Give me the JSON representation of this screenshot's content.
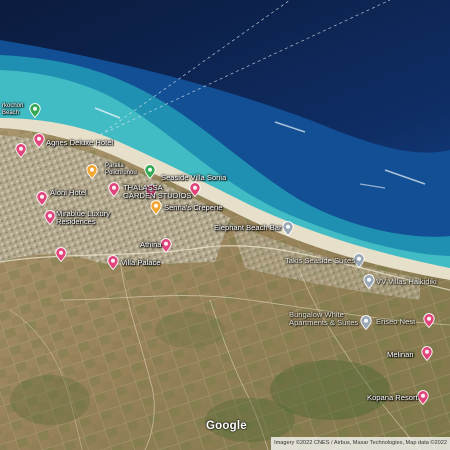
{
  "colors": {
    "deep_sea": "#0b1b3d",
    "mid_sea": "#12478c",
    "shallow_sea": "#2ca9bf",
    "turquoise": "#49c6c6",
    "beach": "#e8e0c8",
    "land": "#9e8760",
    "town": "#b1a88f",
    "hotel_pin": "#e0457b",
    "orange_pin": "#f2a531",
    "green_pin": "#34a853",
    "place_pin": "#9aa7b4"
  },
  "places": [
    {
      "name": "rkochori Beach",
      "kind": "green",
      "label_lines": [
        "rkochori",
        "Beach"
      ]
    },
    {
      "name": "Agnes Deluxe Hotel",
      "kind": "hotel",
      "label_lines": [
        "Agnes Deluxe Hotel"
      ]
    },
    {
      "name": "Paralia Polichronou",
      "kind": "green",
      "label_lines": [
        "Paralia",
        "Polichronou"
      ]
    },
    {
      "name": "Seaside Villa Sonia",
      "kind": "hotel",
      "label_lines": [
        "Seaside Villa Sonia"
      ]
    },
    {
      "name": "Aloni Hotel",
      "kind": "hotel",
      "label_lines": [
        "Aloni Hotel"
      ]
    },
    {
      "name": "THALASSA GARDEN STUDIOS",
      "kind": "hotel",
      "label_lines": [
        "THALASSA",
        "GARDEN STUDIOS"
      ]
    },
    {
      "name": "Mirablue Luxury Residences",
      "kind": "hotel",
      "label_lines": [
        "Mirablue Luxury",
        "Residences"
      ]
    },
    {
      "name": "Senna's Creperie",
      "kind": "orange",
      "label_lines": [
        "Senna's Creperie"
      ]
    },
    {
      "name": "Elephant Beach Bar",
      "kind": "place",
      "label_lines": [
        "Elephant Beach Bar"
      ]
    },
    {
      "name": "Athina",
      "kind": "hotel",
      "label_lines": [
        "Athina"
      ]
    },
    {
      "name": "Villa Palace",
      "kind": "hotel",
      "label_lines": [
        "Villa Palace"
      ]
    },
    {
      "name": "Takis Seaside Suites",
      "kind": "place",
      "label_lines": [
        "Takis Seaside Suites"
      ]
    },
    {
      "name": "VV Villas Halkidiki",
      "kind": "place",
      "label_lines": [
        "VV Villas Halkidiki"
      ]
    },
    {
      "name": "Bungalow White Apartments & Suites",
      "kind": "place",
      "label_lines": [
        "Bungalow White",
        "Apartments & Suites"
      ]
    },
    {
      "name": "Eriseo Nest",
      "kind": "hotel",
      "label_lines": [
        "Eriseo Nest"
      ]
    },
    {
      "name": "Melinari",
      "kind": "hotel",
      "label_lines": [
        "Melinari"
      ]
    },
    {
      "name": "Kopana Resort",
      "kind": "hotel",
      "label_lines": [
        "Kopana Resort"
      ]
    }
  ],
  "extra_pins": [
    "hotel",
    "hotel",
    "orange",
    "hotel"
  ],
  "google_logo": "Google",
  "attribution": "Imagery ©2022 CNES / Airbus, Maxar Technologies, Map data ©2022"
}
